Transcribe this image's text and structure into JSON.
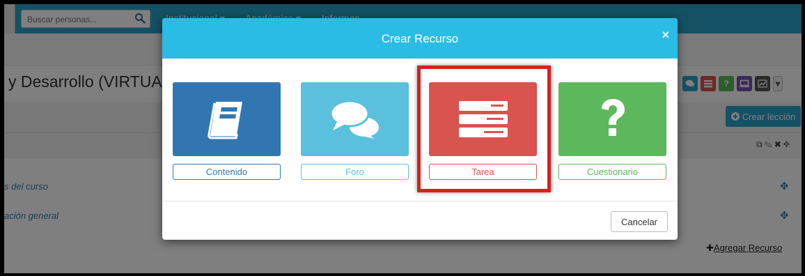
{
  "search": {
    "placeholder": "Buscar personas..."
  },
  "nav": {
    "items": [
      {
        "label": "Institucional",
        "caret": "▾"
      },
      {
        "label": "Académico",
        "caret": "▾"
      },
      {
        "label": "Informes"
      }
    ]
  },
  "course": {
    "title": "y Desarrollo (VIRTUA"
  },
  "toolbar": {
    "help_label": "?",
    "colors": {
      "chat": "#2aa3c9",
      "list": "#d9534f",
      "help": "#5cb85c",
      "screen": "#7a4fb5",
      "chart": "#555555"
    }
  },
  "actions": {
    "crear_leccion": "Crear lección",
    "agregar_recurso": "Agregar Recurso"
  },
  "list": {
    "items": [
      "s del curso",
      "ación general"
    ]
  },
  "modal": {
    "title": "Crear Recurso",
    "close": "×",
    "cancel": "Cancelar",
    "options": [
      {
        "label": "Contenido",
        "color": "#3276b1",
        "icon": "book-icon"
      },
      {
        "label": "Foro",
        "color": "#5bc0de",
        "icon": "chat-bubbles-icon"
      },
      {
        "label": "Tarea",
        "color": "#d9534f",
        "icon": "task-list-icon"
      },
      {
        "label": "Cuestionario",
        "color": "#5cb85c",
        "icon": "question-mark-icon"
      }
    ],
    "highlighted_option": "Tarea"
  }
}
